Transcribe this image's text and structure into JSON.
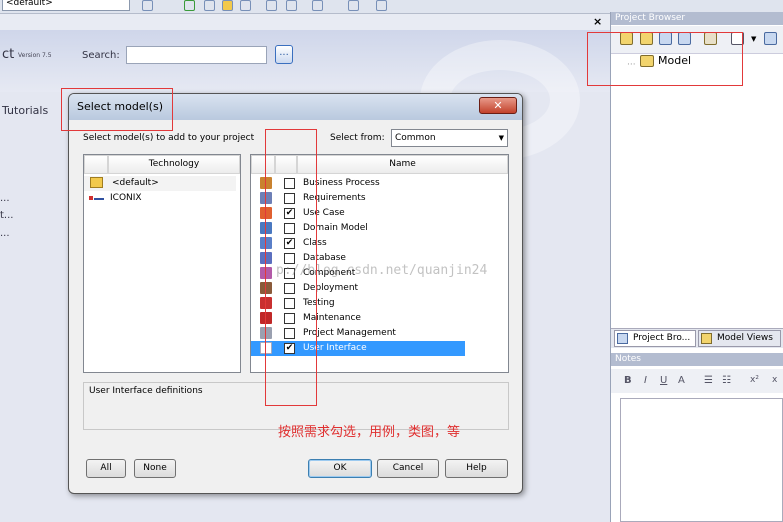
{
  "toolbar": {
    "model_combo": "<default>"
  },
  "left_panel": {
    "version_label": "Version 7.5",
    "heading_fragment": "ct",
    "search_label": "Search:",
    "search_button": "...",
    "tutorials": "Tutorials",
    "dots": [
      "...",
      "t...",
      "..."
    ]
  },
  "project_browser": {
    "title": "Project Browser",
    "model_node": "Model",
    "tabs": [
      "Project Bro...",
      "Model Views"
    ]
  },
  "notes": {
    "title": "Notes",
    "tools": [
      "B",
      "I",
      "U",
      "A",
      "☰",
      "☷",
      "x²",
      "x"
    ]
  },
  "dialog": {
    "title": "Select model(s)",
    "close": "✕",
    "instruction": "Select model(s) to add to your project",
    "select_from_label": "Select from:",
    "select_from_value": "Common",
    "technology_header": "Technology",
    "name_header": "Name",
    "technologies": [
      {
        "label": "<default>",
        "icon": "folder-icon",
        "selected": true
      },
      {
        "label": "ICONIX",
        "icon": "iconix-icon",
        "selected": false
      }
    ],
    "models": [
      {
        "label": "Business Process",
        "checked": false,
        "icon_color": "#c9822f"
      },
      {
        "label": "Requirements",
        "checked": false,
        "icon_color": "#6d7fb6"
      },
      {
        "label": "Use Case",
        "checked": true,
        "icon_color": "#e06030"
      },
      {
        "label": "Domain Model",
        "checked": false,
        "icon_color": "#4a78c0"
      },
      {
        "label": "Class",
        "checked": true,
        "icon_color": "#5a7fc8"
      },
      {
        "label": "Database",
        "checked": false,
        "icon_color": "#5b6fbf"
      },
      {
        "label": "Component",
        "checked": false,
        "icon_color": "#b35aa8"
      },
      {
        "label": "Deployment",
        "checked": false,
        "icon_color": "#8a5a3a"
      },
      {
        "label": "Testing",
        "checked": false,
        "icon_color": "#c93030"
      },
      {
        "label": "Maintenance",
        "checked": false,
        "icon_color": "#c02828"
      },
      {
        "label": "Project Management",
        "checked": false,
        "icon_color": "#9aa0b0"
      },
      {
        "label": "User Interface",
        "checked": true,
        "icon_color": "#b0b8d0",
        "selected": true
      }
    ],
    "description": "User Interface definitions",
    "buttons": {
      "all": "All",
      "none": "None",
      "ok": "OK",
      "cancel": "Cancel",
      "help": "Help"
    }
  },
  "annotation": {
    "note": "按照需求勾选，用例，类图，等",
    "watermark": "p://blog.csdn.net/quanjin24"
  },
  "colors": {
    "selection": "#3399ff",
    "annotation": "#e2393a",
    "header": "#b3bcd0"
  }
}
